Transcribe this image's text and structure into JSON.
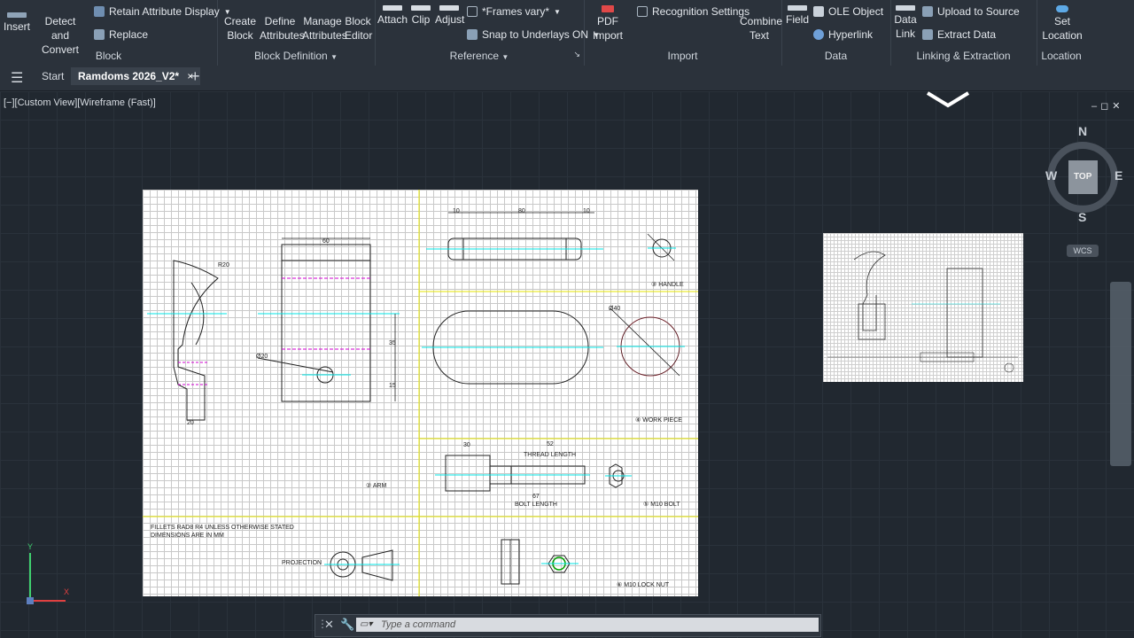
{
  "ribbon": {
    "block_panel": {
      "title": "Block",
      "insert": "Insert",
      "detect_convert": [
        "Detect and",
        "Convert"
      ],
      "retain_attr": "Retain Attribute Display",
      "replace": "Replace"
    },
    "block_def_panel": {
      "title": "Block Definition",
      "create_block": [
        "Create",
        "Block"
      ],
      "define_attr": [
        "Define",
        "Attributes"
      ],
      "manage_attr": [
        "Manage",
        "Attributes"
      ],
      "block_editor": [
        "Block",
        "Editor"
      ]
    },
    "reference_panel": {
      "title": "Reference",
      "attach": "Attach",
      "clip": "Clip",
      "adjust": "Adjust",
      "frames": "*Frames vary*",
      "snap": "Snap to Underlays ON"
    },
    "import_panel": {
      "title": "Import",
      "pdf_import": [
        "PDF",
        "Import"
      ],
      "recognition": "Recognition Settings",
      "combine_text": [
        "Combine",
        "Text"
      ]
    },
    "data_panel": {
      "title": "Data",
      "field": "Field",
      "ole": "OLE Object",
      "hyperlink": "Hyperlink"
    },
    "linking_panel": {
      "title": "Linking & Extraction",
      "data_link": [
        "Data",
        "Link"
      ],
      "upload": "Upload to Source",
      "extract": "Extract  Data"
    },
    "location_panel": {
      "title": "Location",
      "set_location": [
        "Set",
        "Location"
      ]
    }
  },
  "tabs": {
    "start": "Start",
    "active": "Ramdoms 2026_V2*",
    "close": "×",
    "add": "+"
  },
  "viewport": {
    "label": "[−][Custom View][Wireframe (Fast)]",
    "controls": "–◻✕"
  },
  "drawing": {
    "dims": {
      "arm_top_width": "60",
      "handle_total": "80",
      "handle_end_left": "10",
      "handle_end_right": "10",
      "bolt_thread_dim": "52",
      "bolt_len_dim": "67",
      "bolt_head_dim": "30",
      "arm_base_width": "20",
      "hole_dia": "Ø20",
      "workpiece_dia": "Ø40",
      "arm_r": "R20",
      "side_h1": "35",
      "side_h2": "15"
    },
    "labels": {
      "handle": "③ HANDLE",
      "workpiece": "④ WORK PIECE",
      "arm": "② ARM",
      "bolt": "⑤ M10 BOLT",
      "locknut": "⑥ M10 LOCK NUT",
      "thread_length": "THREAD LENGTH",
      "bolt_length": "BOLT LENGTH",
      "projection": "PROJECTION",
      "notes_line1": "FILLETS RAD8  R4 UNLESS OTHERWISE STATED",
      "notes_line2": "DIMENSIONS ARE IN MM"
    }
  },
  "compass": {
    "n": "N",
    "s": "S",
    "e": "E",
    "w": "W",
    "top": "TOP",
    "wcs": "WCS"
  },
  "command": {
    "placeholder": "Type a command"
  },
  "ucs": {
    "y": "Y",
    "x": "X"
  },
  "colors": {
    "bg": "#212830",
    "ribbon": "#2b323b",
    "accent_cyan": "#00e5e5",
    "accent_magenta": "#d000d0",
    "accent_yellow": "#e6e600"
  }
}
